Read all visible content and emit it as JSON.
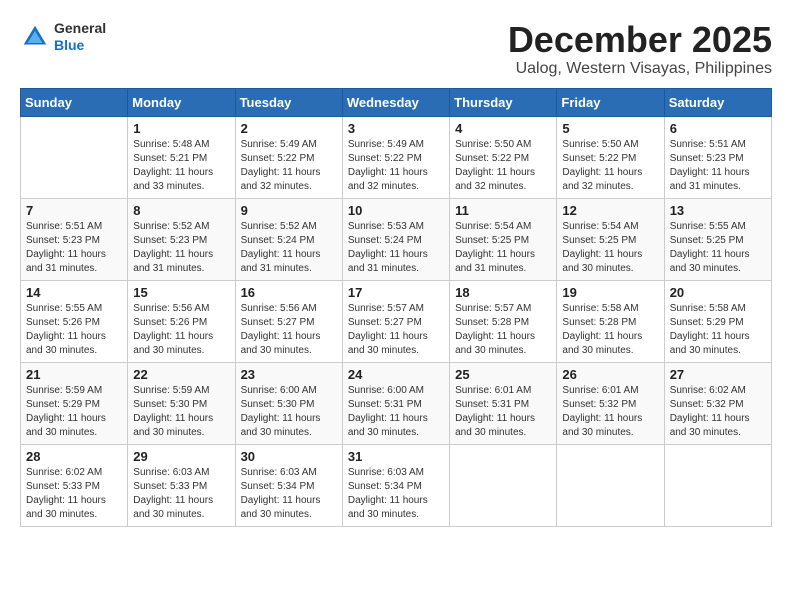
{
  "header": {
    "logo_general": "General",
    "logo_blue": "Blue",
    "month": "December 2025",
    "location": "Ualog, Western Visayas, Philippines"
  },
  "weekdays": [
    "Sunday",
    "Monday",
    "Tuesday",
    "Wednesday",
    "Thursday",
    "Friday",
    "Saturday"
  ],
  "weeks": [
    [
      {
        "day": "",
        "sunrise": "",
        "sunset": "",
        "daylight": ""
      },
      {
        "day": "1",
        "sunrise": "Sunrise: 5:48 AM",
        "sunset": "Sunset: 5:21 PM",
        "daylight": "Daylight: 11 hours and 33 minutes."
      },
      {
        "day": "2",
        "sunrise": "Sunrise: 5:49 AM",
        "sunset": "Sunset: 5:22 PM",
        "daylight": "Daylight: 11 hours and 32 minutes."
      },
      {
        "day": "3",
        "sunrise": "Sunrise: 5:49 AM",
        "sunset": "Sunset: 5:22 PM",
        "daylight": "Daylight: 11 hours and 32 minutes."
      },
      {
        "day": "4",
        "sunrise": "Sunrise: 5:50 AM",
        "sunset": "Sunset: 5:22 PM",
        "daylight": "Daylight: 11 hours and 32 minutes."
      },
      {
        "day": "5",
        "sunrise": "Sunrise: 5:50 AM",
        "sunset": "Sunset: 5:22 PM",
        "daylight": "Daylight: 11 hours and 32 minutes."
      },
      {
        "day": "6",
        "sunrise": "Sunrise: 5:51 AM",
        "sunset": "Sunset: 5:23 PM",
        "daylight": "Daylight: 11 hours and 31 minutes."
      }
    ],
    [
      {
        "day": "7",
        "sunrise": "Sunrise: 5:51 AM",
        "sunset": "Sunset: 5:23 PM",
        "daylight": "Daylight: 11 hours and 31 minutes."
      },
      {
        "day": "8",
        "sunrise": "Sunrise: 5:52 AM",
        "sunset": "Sunset: 5:23 PM",
        "daylight": "Daylight: 11 hours and 31 minutes."
      },
      {
        "day": "9",
        "sunrise": "Sunrise: 5:52 AM",
        "sunset": "Sunset: 5:24 PM",
        "daylight": "Daylight: 11 hours and 31 minutes."
      },
      {
        "day": "10",
        "sunrise": "Sunrise: 5:53 AM",
        "sunset": "Sunset: 5:24 PM",
        "daylight": "Daylight: 11 hours and 31 minutes."
      },
      {
        "day": "11",
        "sunrise": "Sunrise: 5:54 AM",
        "sunset": "Sunset: 5:25 PM",
        "daylight": "Daylight: 11 hours and 31 minutes."
      },
      {
        "day": "12",
        "sunrise": "Sunrise: 5:54 AM",
        "sunset": "Sunset: 5:25 PM",
        "daylight": "Daylight: 11 hours and 30 minutes."
      },
      {
        "day": "13",
        "sunrise": "Sunrise: 5:55 AM",
        "sunset": "Sunset: 5:25 PM",
        "daylight": "Daylight: 11 hours and 30 minutes."
      }
    ],
    [
      {
        "day": "14",
        "sunrise": "Sunrise: 5:55 AM",
        "sunset": "Sunset: 5:26 PM",
        "daylight": "Daylight: 11 hours and 30 minutes."
      },
      {
        "day": "15",
        "sunrise": "Sunrise: 5:56 AM",
        "sunset": "Sunset: 5:26 PM",
        "daylight": "Daylight: 11 hours and 30 minutes."
      },
      {
        "day": "16",
        "sunrise": "Sunrise: 5:56 AM",
        "sunset": "Sunset: 5:27 PM",
        "daylight": "Daylight: 11 hours and 30 minutes."
      },
      {
        "day": "17",
        "sunrise": "Sunrise: 5:57 AM",
        "sunset": "Sunset: 5:27 PM",
        "daylight": "Daylight: 11 hours and 30 minutes."
      },
      {
        "day": "18",
        "sunrise": "Sunrise: 5:57 AM",
        "sunset": "Sunset: 5:28 PM",
        "daylight": "Daylight: 11 hours and 30 minutes."
      },
      {
        "day": "19",
        "sunrise": "Sunrise: 5:58 AM",
        "sunset": "Sunset: 5:28 PM",
        "daylight": "Daylight: 11 hours and 30 minutes."
      },
      {
        "day": "20",
        "sunrise": "Sunrise: 5:58 AM",
        "sunset": "Sunset: 5:29 PM",
        "daylight": "Daylight: 11 hours and 30 minutes."
      }
    ],
    [
      {
        "day": "21",
        "sunrise": "Sunrise: 5:59 AM",
        "sunset": "Sunset: 5:29 PM",
        "daylight": "Daylight: 11 hours and 30 minutes."
      },
      {
        "day": "22",
        "sunrise": "Sunrise: 5:59 AM",
        "sunset": "Sunset: 5:30 PM",
        "daylight": "Daylight: 11 hours and 30 minutes."
      },
      {
        "day": "23",
        "sunrise": "Sunrise: 6:00 AM",
        "sunset": "Sunset: 5:30 PM",
        "daylight": "Daylight: 11 hours and 30 minutes."
      },
      {
        "day": "24",
        "sunrise": "Sunrise: 6:00 AM",
        "sunset": "Sunset: 5:31 PM",
        "daylight": "Daylight: 11 hours and 30 minutes."
      },
      {
        "day": "25",
        "sunrise": "Sunrise: 6:01 AM",
        "sunset": "Sunset: 5:31 PM",
        "daylight": "Daylight: 11 hours and 30 minutes."
      },
      {
        "day": "26",
        "sunrise": "Sunrise: 6:01 AM",
        "sunset": "Sunset: 5:32 PM",
        "daylight": "Daylight: 11 hours and 30 minutes."
      },
      {
        "day": "27",
        "sunrise": "Sunrise: 6:02 AM",
        "sunset": "Sunset: 5:32 PM",
        "daylight": "Daylight: 11 hours and 30 minutes."
      }
    ],
    [
      {
        "day": "28",
        "sunrise": "Sunrise: 6:02 AM",
        "sunset": "Sunset: 5:33 PM",
        "daylight": "Daylight: 11 hours and 30 minutes."
      },
      {
        "day": "29",
        "sunrise": "Sunrise: 6:03 AM",
        "sunset": "Sunset: 5:33 PM",
        "daylight": "Daylight: 11 hours and 30 minutes."
      },
      {
        "day": "30",
        "sunrise": "Sunrise: 6:03 AM",
        "sunset": "Sunset: 5:34 PM",
        "daylight": "Daylight: 11 hours and 30 minutes."
      },
      {
        "day": "31",
        "sunrise": "Sunrise: 6:03 AM",
        "sunset": "Sunset: 5:34 PM",
        "daylight": "Daylight: 11 hours and 30 minutes."
      },
      {
        "day": "",
        "sunrise": "",
        "sunset": "",
        "daylight": ""
      },
      {
        "day": "",
        "sunrise": "",
        "sunset": "",
        "daylight": ""
      },
      {
        "day": "",
        "sunrise": "",
        "sunset": "",
        "daylight": ""
      }
    ]
  ]
}
